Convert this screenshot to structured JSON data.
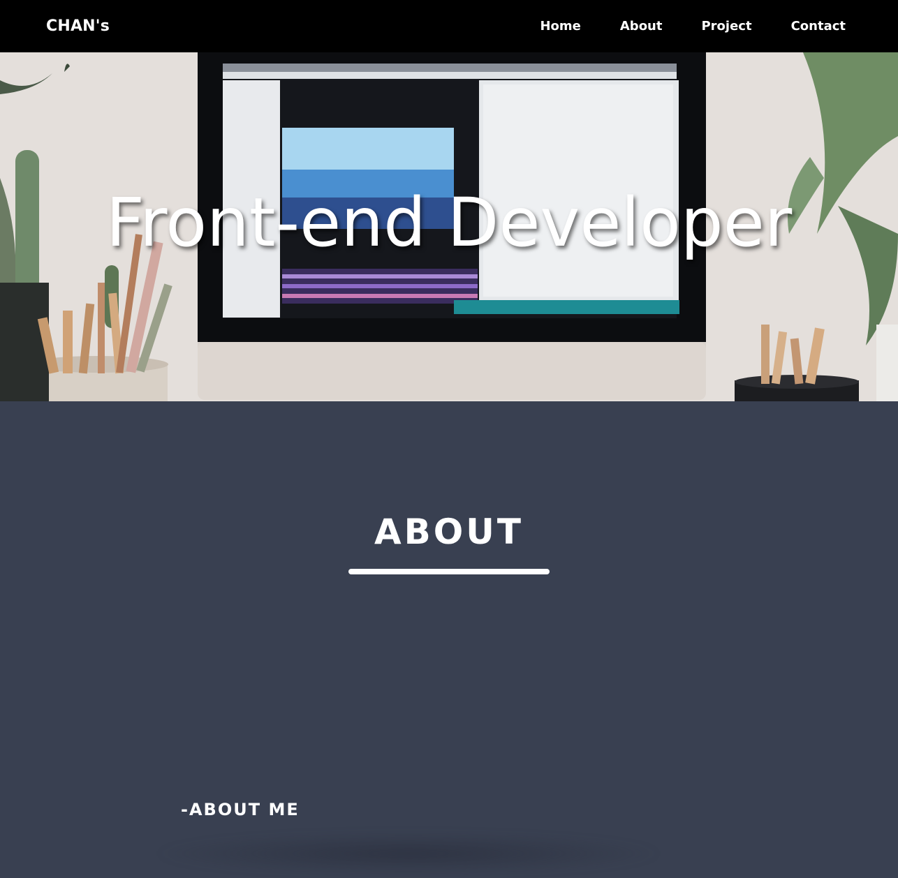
{
  "nav": {
    "logo": "CHAN's",
    "links": [
      "Home",
      "About",
      "Project",
      "Contact"
    ]
  },
  "hero": {
    "title": "Front-end Developer"
  },
  "about": {
    "heading": "ABOUT",
    "subheading": "-ABOUT ME"
  },
  "colors": {
    "navbar": "#000000",
    "section_bg": "#394051",
    "text": "#ffffff"
  }
}
